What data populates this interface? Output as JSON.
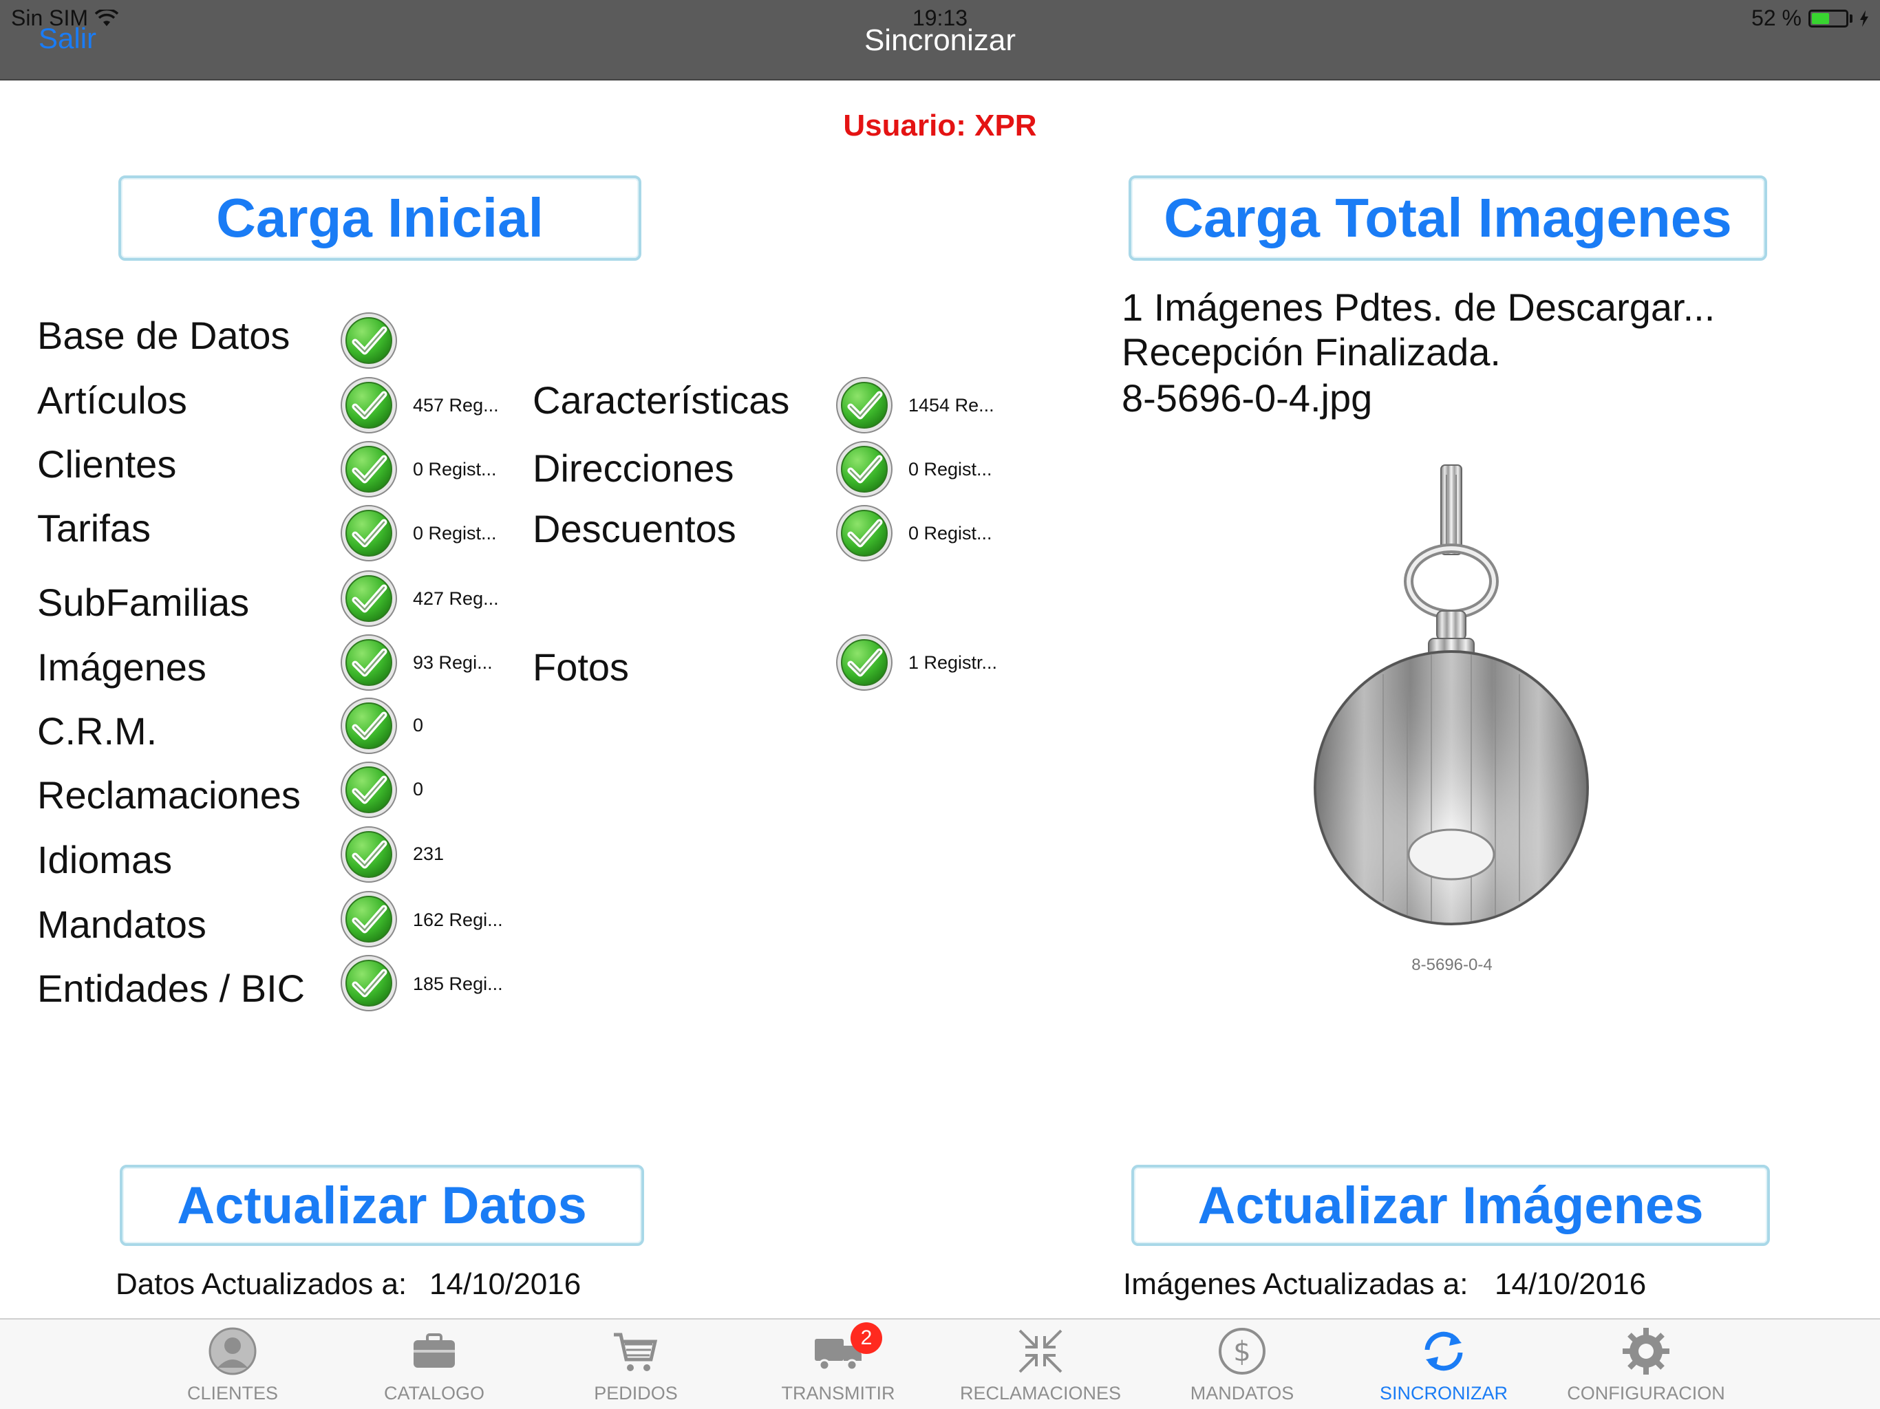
{
  "status_bar": {
    "carrier": "Sin SIM",
    "time": "19:13",
    "battery_percent_text": "52 %",
    "battery_level": 0.52
  },
  "nav": {
    "back_label": "Salir",
    "title": "Sincronizar"
  },
  "user": {
    "label": "Usuario: XPR"
  },
  "buttons": {
    "carga_inicial": "Carga Inicial",
    "carga_total_imagenes": "Carga Total Imagenes",
    "actualizar_datos": "Actualizar Datos",
    "actualizar_imagenes": "Actualizar Imágenes"
  },
  "sync_left": [
    {
      "label": "Base de Datos",
      "count": ""
    },
    {
      "label": "Artículos",
      "count": "457 Reg..."
    },
    {
      "label": "Clientes",
      "count": "0 Regist..."
    },
    {
      "label": "Tarifas",
      "count": "0 Regist..."
    },
    {
      "label": "SubFamilias",
      "count": "427 Reg..."
    },
    {
      "label": "Imágenes",
      "count": "93 Regi..."
    },
    {
      "label": "C.R.M.",
      "count": "0"
    },
    {
      "label": "Reclamaciones",
      "count": "0"
    },
    {
      "label": "Idiomas",
      "count": "231"
    },
    {
      "label": "Mandatos",
      "count": "162 Regi..."
    },
    {
      "label": "Entidades / BIC",
      "count": "185 Regi..."
    }
  ],
  "sync_mid": [
    {
      "label": "Características",
      "count": "1454 Re..."
    },
    {
      "label": "Direcciones",
      "count": "0 Regist..."
    },
    {
      "label": "Descuentos",
      "count": "0 Regist..."
    },
    {
      "label": "Fotos",
      "count": "1 Registr..."
    }
  ],
  "images_status": {
    "pending": "1 Imágenes Pdtes. de Descargar...",
    "received": "Recepción Finalizada.",
    "filename": "8-5696-0-4.jpg",
    "caption": "8-5696-0-4"
  },
  "footer": {
    "datos_label": "Datos Actualizados a:",
    "datos_date": "14/10/2016",
    "imagenes_label": "Imágenes Actualizadas a:",
    "imagenes_date": "14/10/2016"
  },
  "tabs": [
    {
      "label": "CLIENTES",
      "icon": "person-icon"
    },
    {
      "label": "CATALOGO",
      "icon": "briefcase-icon"
    },
    {
      "label": "PEDIDOS",
      "icon": "cart-icon"
    },
    {
      "label": "TRANSMITIR",
      "icon": "truck-icon",
      "badge": "2"
    },
    {
      "label": "RECLAMACIONES",
      "icon": "arrows-inward-icon"
    },
    {
      "label": "MANDATOS",
      "icon": "dollar-icon"
    },
    {
      "label": "SINCRONIZAR",
      "icon": "sync-icon",
      "active": true
    },
    {
      "label": "CONFIGURACION",
      "icon": "gear-icon"
    }
  ],
  "colors": {
    "accent": "#1a7cf5",
    "user_red": "#e41313",
    "nav_bg": "#5b5b5b",
    "check_green": "#3bb52a",
    "badge_red": "#ff2a1f"
  }
}
